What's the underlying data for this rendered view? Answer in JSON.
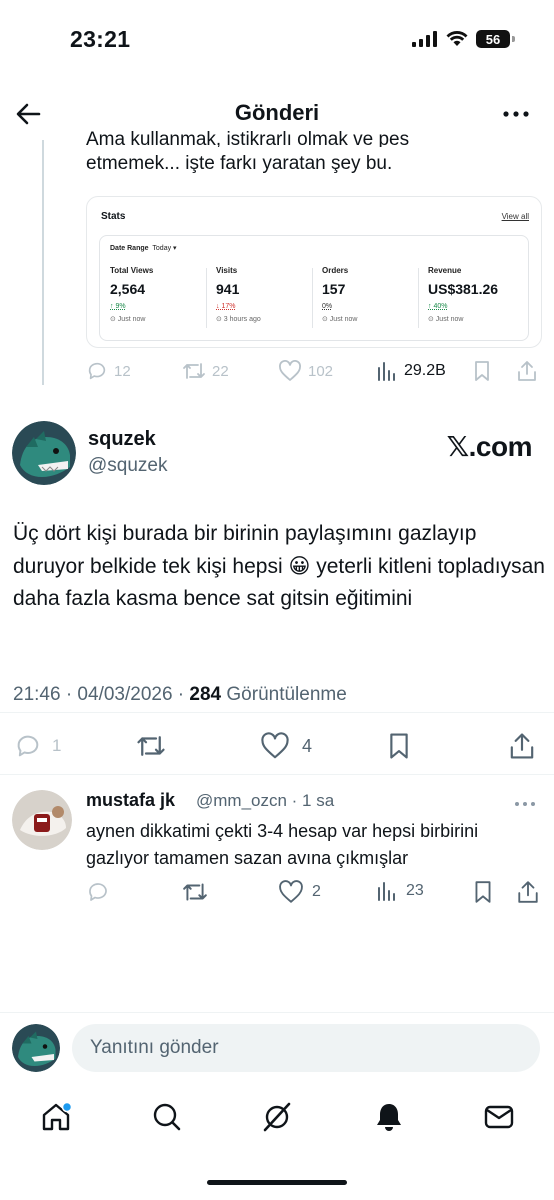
{
  "status_bar": {
    "time": "23:21",
    "battery": "56"
  },
  "header": {
    "title": "Gönderi"
  },
  "quoted": {
    "partial_line": "Ama kullanmak, istikrarlı olmak ve pes",
    "line2": "etmemek... işte farkı yaratan şey bu.",
    "stats": {
      "title": "Stats",
      "view_all": "View all",
      "date_range_label": "Date Range",
      "date_range_value": "Today ▾",
      "cols": [
        {
          "label": "Total Views",
          "value": "2,564",
          "change": "↑ 9%",
          "change_color": "#1a8a4a",
          "time": "⊙ Just now"
        },
        {
          "label": "Visits",
          "value": "941",
          "change": "↓ 17%",
          "change_color": "#d0312d",
          "time": "⊙ 3 hours ago"
        },
        {
          "label": "Orders",
          "value": "157",
          "change": "0%",
          "change_color": "#333333",
          "time": "⊙ Just now"
        },
        {
          "label": "Revenue",
          "value": "US$381.26",
          "change": "↑ 40%",
          "change_color": "#1a8a4a",
          "time": "⊙ Just now"
        }
      ]
    },
    "actions": {
      "replies": "12",
      "retweets": "22",
      "likes": "102",
      "views": "29.2B"
    }
  },
  "tweet": {
    "name": "squzek",
    "handle": "@squzek",
    "source": "𝕏.com",
    "body": "Üç dört kişi burada bir birinin paylaşımını gazlayıp duruyor belkide tek kişi hepsi 😀 yeterli kitleni topladıysan daha fazla kasma bence sat gitsin eğitimini",
    "time": "21:46 · 04/03/2026 · ",
    "views": "284",
    "views_label": " Görüntülenme",
    "actions": {
      "replies": "1",
      "likes": "4"
    }
  },
  "reply": {
    "name": "mustafa jk",
    "handle": "@mm_ozcn · 1 sa",
    "body": "aynen dikkatimi çekti 3-4 hesap var hepsi birbirini gazlıyor tamamen sazan avına çıkmışlar",
    "actions": {
      "likes": "2",
      "views": "23"
    }
  },
  "compose": {
    "placeholder": "Yanıtını gönder"
  },
  "colors": {
    "accent": "#1d9bf0",
    "muted": "#536471",
    "faded": "#b8c2c9"
  },
  "icons": [
    "back-arrow-icon",
    "more-icon",
    "reply-icon",
    "retweet-icon",
    "heart-icon",
    "views-icon",
    "bookmark-icon",
    "share-icon",
    "home-icon",
    "search-icon",
    "grok-icon",
    "bell-icon",
    "mail-icon"
  ]
}
